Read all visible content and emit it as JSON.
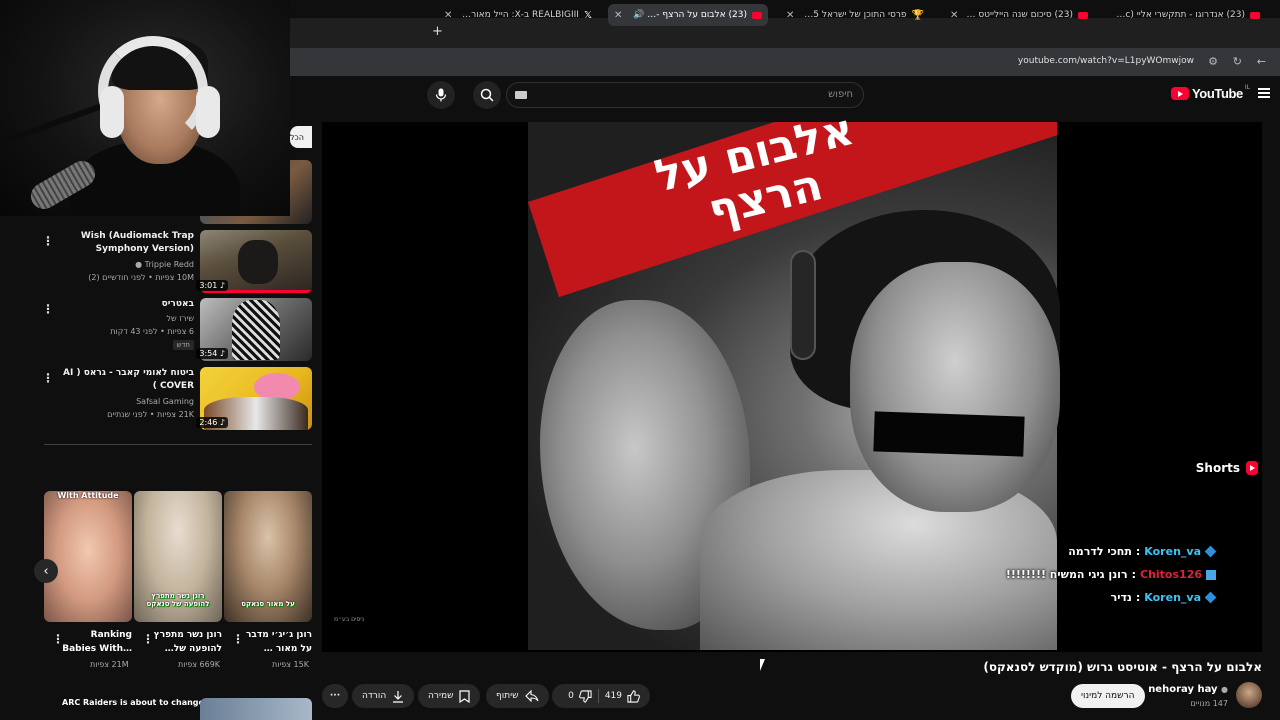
{
  "browser": {
    "tabs": [
      {
        "title": "(23) אנדרוגו - תתקשרי אליי (Offic…",
        "icon": "youtube-icon",
        "audio": true
      },
      {
        "title": "(23) סיכום שנה היילייטס (חלק…",
        "icon": "youtube-icon",
        "audio": false
      },
      {
        "title": "פרסי התוכן של ישראל 2025 | המ…",
        "icon": "trophy-icon",
        "audio": false
      },
      {
        "title": "(23) אלבום על הרצף - אוטיסט…",
        "icon": "youtube-icon",
        "audio": true,
        "active": true
      },
      {
        "title": "REALBIGIII ב-X: הייל מאור דיס…",
        "icon": "x-icon",
        "audio": false
      }
    ],
    "new_tab": "+",
    "url": "youtube.com/watch?v=L1pyWOmwjow"
  },
  "header": {
    "logo_text": "YouTube",
    "logo_country": "IL",
    "search_placeholder": "חיפוש"
  },
  "player": {
    "art_title": "אלבום על הרצף",
    "small_watermark": "ניסים בע״מ",
    "chat": [
      {
        "user": "Koren_va",
        "user_color": "#3dc4f0",
        "message": "תחכי לדרמה"
      },
      {
        "user": "Chitos126",
        "user_color": "#e0213a",
        "message": "רונן גיגי המשיח !!!!!!!!"
      },
      {
        "user": "Koren_va",
        "user_color": "#3dc4f0",
        "message": "נדיר"
      }
    ]
  },
  "video": {
    "title": "אלבום על הרצף - אוטיסט גרוש (מוקדש לסנאקס)",
    "channel": "nehoray hay",
    "subscribers": "147 מנויים",
    "subscribe_label": "הרשמה למינוי",
    "likes": "419",
    "dislikes": "0",
    "share_label": "שיתוף",
    "save_label": "שמירה",
    "download_label": "הורדה",
    "more_label": "···"
  },
  "sidebar": {
    "chip_partial": "הכל",
    "recommendations": [
      {
        "title": "Wish (Audiomack Trap Symphony Version)",
        "channel": "Trippie Redd",
        "meta": "10M צפיות • לפני חודשיים (2)",
        "duration": "3:01",
        "badge": ""
      },
      {
        "title": "באטריס",
        "channel": "שירז של",
        "meta": "6 צפיות • לפני 43 דקות",
        "duration": "3:54",
        "badge": "חדש"
      },
      {
        "title": "ביטוח לאומי קאבר - גראס ( AI COVER )",
        "channel": "Safsal Gaming",
        "meta": "21K צפיות • לפני שנתיים",
        "duration": "2:46",
        "badge": ""
      }
    ],
    "shorts_title": "Shorts",
    "shorts": [
      {
        "title": "רונן ג׳יג׳י מדבר על מאור …",
        "views": "15K צפיות",
        "caption": "על מאור סנאקס"
      },
      {
        "title": "רונן נשר מתפרץ להופעה של…",
        "views": "669K צפיות",
        "caption": "רונן נשר מתפרץ להופעה של סנאקס"
      },
      {
        "title": "Ranking Babies With…",
        "views": "21M צפיות",
        "caption": "With Attitude"
      }
    ],
    "next_item": "ARC Raiders is about to change"
  }
}
